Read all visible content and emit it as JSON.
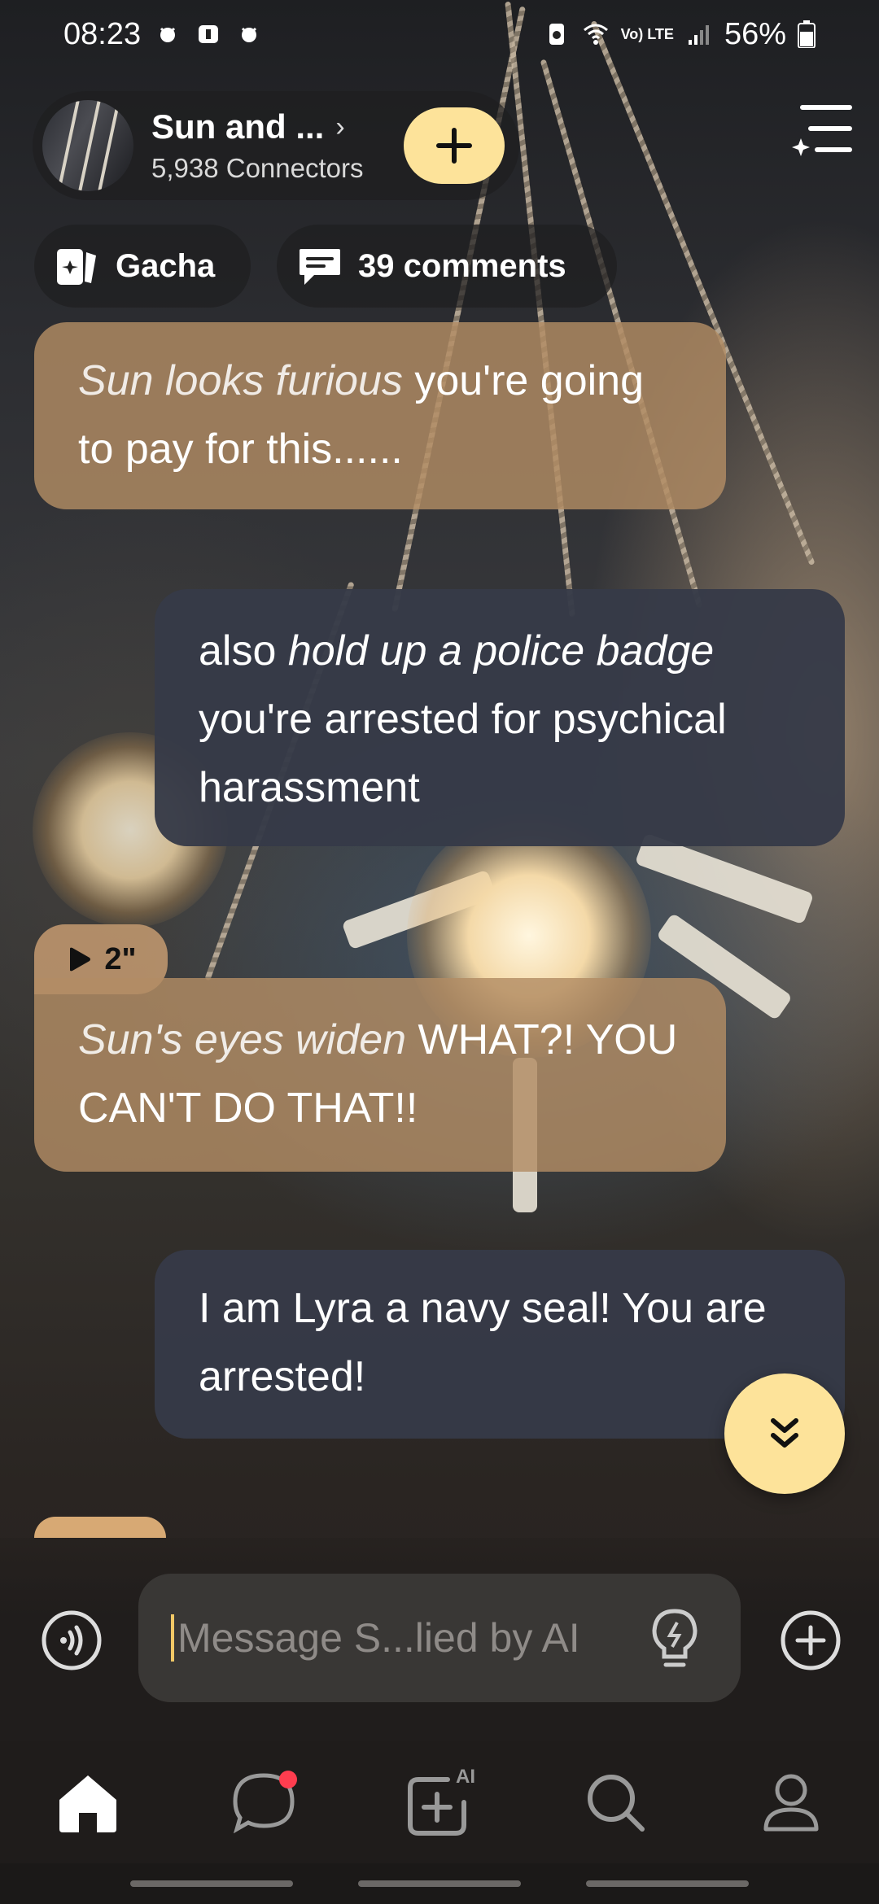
{
  "status_bar": {
    "time": "08:23",
    "battery": "56%",
    "network": "Vo) LTE"
  },
  "header": {
    "character_name": "Sun and ...",
    "connectors": "5,938 Connectors",
    "add_icon": "plus-icon",
    "menu_icon": "menu-sparkle-icon"
  },
  "chips": {
    "gacha_label": "Gacha",
    "comments_label": "39 comments"
  },
  "messages": [
    {
      "role": "bot",
      "action": "Sun looks furious",
      "text": " you're going to pay for this......"
    },
    {
      "role": "user",
      "prefix": "also ",
      "action": "hold up a police badge",
      "text": " you're arrested for psychical harassment"
    },
    {
      "role": "bot",
      "audio_duration": "2\"",
      "action": "Sun's eyes widen",
      "text": " WHAT?! YOU CAN'T DO THAT!!"
    },
    {
      "role": "user",
      "text": "I am Lyra a navy seal! You are arrested!"
    }
  ],
  "input": {
    "placeholder": "Message S...lied by AI"
  },
  "bottom_nav": {
    "items": [
      "home-icon",
      "chat-icon",
      "create-ai-icon",
      "search-icon",
      "profile-icon"
    ]
  },
  "colors": {
    "accent_yellow": "#fde39a",
    "bot_bubble": "#b28c64",
    "user_bubble": "#363a48",
    "notification_dot": "#ff3d4f"
  }
}
